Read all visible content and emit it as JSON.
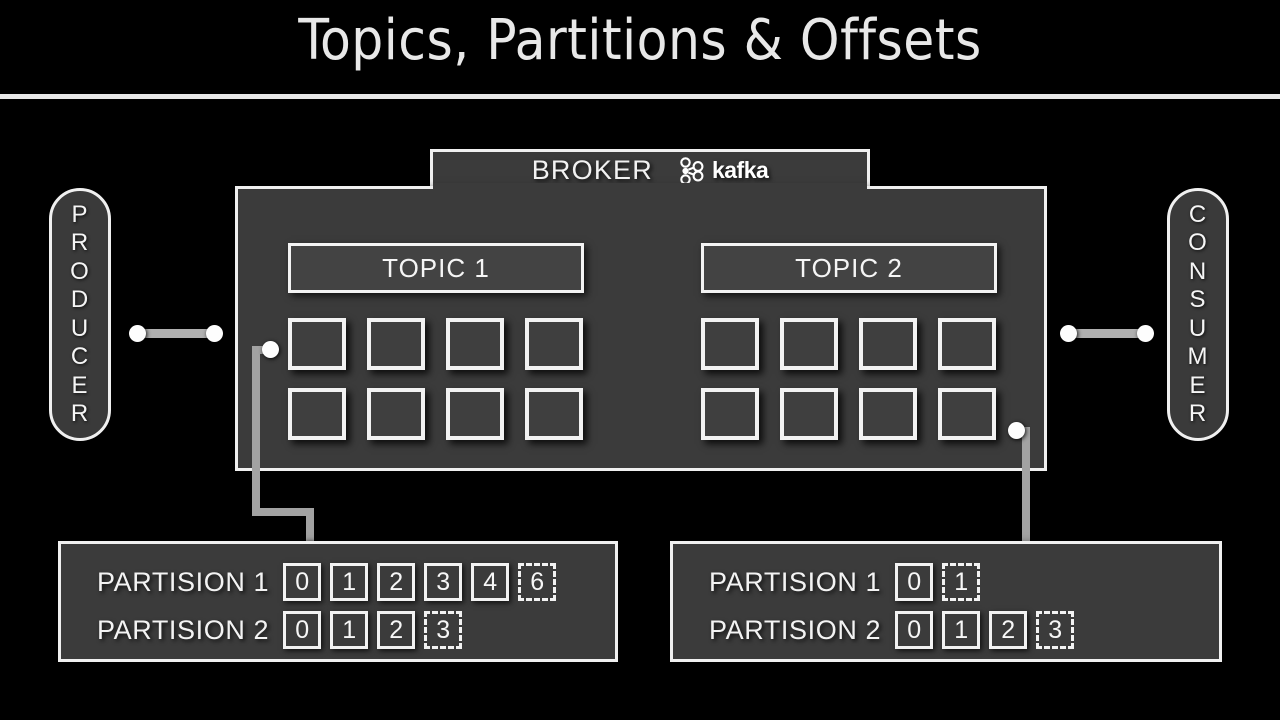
{
  "slide": {
    "title": "Topics, Partitions & Offsets"
  },
  "broker": {
    "label": "BROKER",
    "logo_icon": "kafka-logo-icon",
    "logo_word": "kafka",
    "topics": [
      {
        "name": "TOPIC 1",
        "partition_cells": 8
      },
      {
        "name": "TOPIC 2",
        "partition_cells": 8
      }
    ]
  },
  "producer": {
    "label": "PRODUCER",
    "letters": [
      "P",
      "R",
      "O",
      "D",
      "U",
      "C",
      "E",
      "R"
    ]
  },
  "consumer": {
    "label": "CONSUMER",
    "letters": [
      "C",
      "O",
      "N",
      "S",
      "U",
      "M",
      "E",
      "R"
    ]
  },
  "offset_panels": [
    {
      "id": "topic-1-offsets",
      "rows": [
        {
          "label": "PARTISION 1",
          "offsets": [
            {
              "value": "0",
              "style": "solid"
            },
            {
              "value": "1",
              "style": "solid"
            },
            {
              "value": "2",
              "style": "solid"
            },
            {
              "value": "3",
              "style": "solid"
            },
            {
              "value": "4",
              "style": "solid"
            },
            {
              "value": "6",
              "style": "dashed"
            }
          ]
        },
        {
          "label": "PARTISION 2",
          "offsets": [
            {
              "value": "0",
              "style": "solid"
            },
            {
              "value": "1",
              "style": "solid"
            },
            {
              "value": "2",
              "style": "solid"
            },
            {
              "value": "3",
              "style": "dashed"
            }
          ]
        }
      ]
    },
    {
      "id": "topic-2-offsets",
      "rows": [
        {
          "label": "PARTISION 1",
          "offsets": [
            {
              "value": "0",
              "style": "solid"
            },
            {
              "value": "1",
              "style": "dashed"
            }
          ]
        },
        {
          "label": "PARTISION 2",
          "offsets": [
            {
              "value": "0",
              "style": "solid"
            },
            {
              "value": "1",
              "style": "solid"
            },
            {
              "value": "2",
              "style": "solid"
            },
            {
              "value": "3",
              "style": "dashed"
            }
          ]
        }
      ]
    }
  ],
  "colors": {
    "background": "#000000",
    "panel": "#3b3b3b",
    "stroke": "#f0f0f0",
    "text": "#f3f3f3",
    "connector": "#b0b0b0"
  }
}
